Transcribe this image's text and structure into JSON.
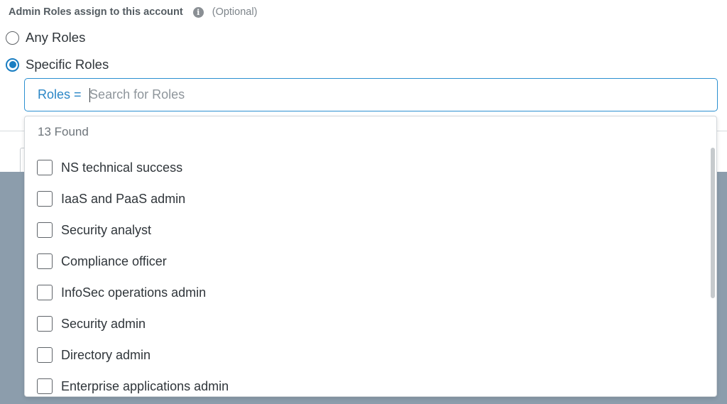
{
  "section": {
    "label": "Admin Roles assign to this account",
    "info_icon": "info-icon",
    "optional_text": "(Optional)"
  },
  "radio_options": [
    {
      "label": "Any Roles",
      "selected": false
    },
    {
      "label": "Specific Roles",
      "selected": true
    }
  ],
  "search": {
    "filter_label": "Roles = ",
    "value": "",
    "placeholder": "Search for Roles"
  },
  "dropdown": {
    "found_text": "13 Found",
    "options": [
      {
        "label": "NS technical success",
        "checked": false
      },
      {
        "label": "IaaS and PaaS admin",
        "checked": false
      },
      {
        "label": "Security analyst",
        "checked": false
      },
      {
        "label": "Compliance officer",
        "checked": false
      },
      {
        "label": "InfoSec operations admin",
        "checked": false
      },
      {
        "label": "Security admin",
        "checked": false
      },
      {
        "label": "Directory admin",
        "checked": false
      },
      {
        "label": "Enterprise applications admin",
        "checked": false
      }
    ]
  },
  "colors": {
    "accent": "#1a7ec2",
    "filter_text": "#2a86c6",
    "background_panel": "#8c9dac"
  }
}
